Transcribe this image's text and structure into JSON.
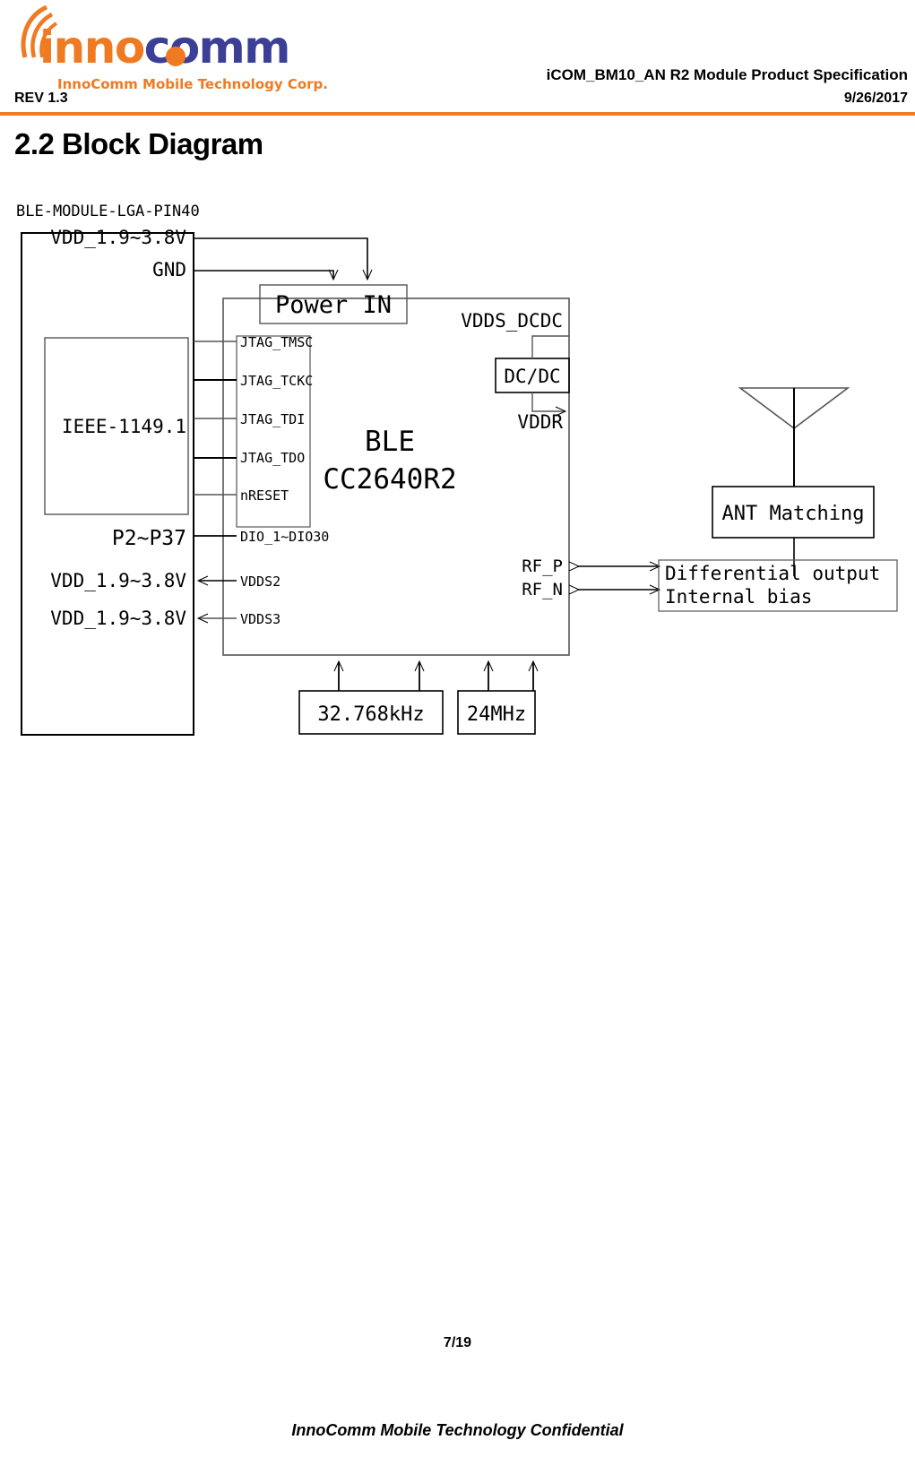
{
  "header": {
    "logo": {
      "wordmark_part1": "inno",
      "wordmark_part2": "comm",
      "tagline": "InnoComm Mobile Technology Corp.",
      "color_orange": "#f07a21",
      "color_blue": "#3b3f96"
    },
    "doc_title": "iCOM_BM10_AN R2 Module Product Specification",
    "revision": "REV 1.3",
    "date": "9/26/2017",
    "rule_color": "#f07a21"
  },
  "section": {
    "title": "2.2 Block Diagram"
  },
  "diagram": {
    "module_caption": "BLE-MODULE-LGA-PIN40",
    "module_pins": {
      "vdd_top": "VDD_1.9~3.8V",
      "gnd": "GND",
      "jtag_group": "IEEE-1149.1",
      "gpio_group": "P2~P37",
      "vdd_s2": "VDD_1.9~3.8V",
      "vdd_s3": "VDD_1.9~3.8V"
    },
    "chip": {
      "name_line1": "BLE",
      "name_line2": "CC2640R2",
      "power_in": "Power IN",
      "signals": [
        "JTAG_TMSC",
        "JTAG_TCKC",
        "JTAG_TDI",
        "JTAG_TDO",
        "nRESET"
      ],
      "dio_label": "DIO_1~DIO30",
      "vdds2": "VDDS2",
      "vdds3": "VDDS3",
      "vdds_dcdc": "VDDS_DCDC",
      "vddr": "VDDR",
      "rf_p": "RF_P",
      "rf_n": "RF_N"
    },
    "dcdc": {
      "label": "DC/DC"
    },
    "crystals": [
      {
        "label": "32.768kHz"
      },
      {
        "label": "24MHz"
      }
    ],
    "rf_chain": {
      "antenna_label": "antenna-symbol",
      "ant_matching": "ANT Matching",
      "diff_out_line1": "Differential output",
      "diff_out_line2": "Internal bias"
    }
  },
  "footer": {
    "page_number": "7/19",
    "confidential": "InnoComm Mobile Technology Confidential"
  }
}
